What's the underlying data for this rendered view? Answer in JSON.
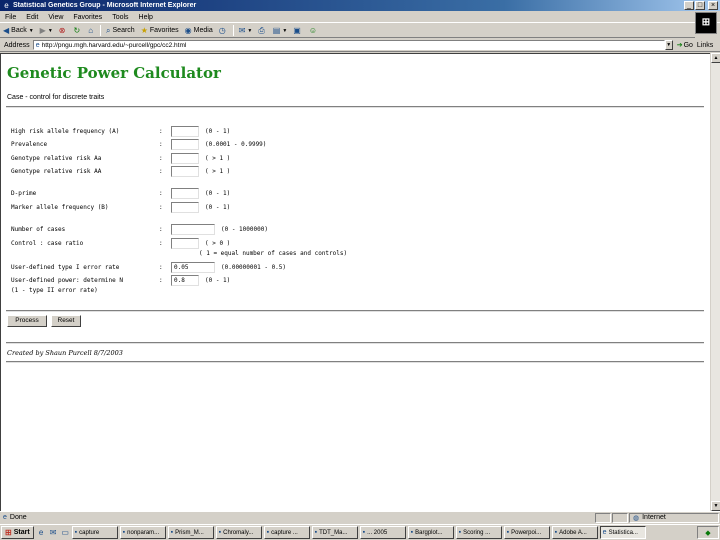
{
  "window": {
    "title": "Statistical Genetics Group - Microsoft Internet Explorer",
    "btn_min": "_",
    "btn_max": "□",
    "btn_close": "×"
  },
  "menu": {
    "items": [
      "File",
      "Edit",
      "View",
      "Favorites",
      "Tools",
      "Help"
    ]
  },
  "toolbar": {
    "back": "Back",
    "forward": "",
    "search": "Search",
    "favorites": "Favorites",
    "media": "Media"
  },
  "address": {
    "label": "Address",
    "url": "http://pngu.mgh.harvard.edu/~purcell/gpc/cc2.html",
    "go": "Go",
    "links": "Links"
  },
  "page": {
    "title": "Genetic Power Calculator",
    "subtitle": "Case - control for discrete traits",
    "fields": [
      {
        "label": "High risk allele frequency (A)",
        "colon": ":",
        "value": "",
        "range": "(0 - 1)"
      },
      {
        "label": "Prevalence",
        "colon": ":",
        "value": "",
        "range": "(0.0001 - 0.9999)"
      },
      {
        "label": "Genotype relative risk Aa",
        "colon": ":",
        "value": "",
        "range": "( > 1 )"
      },
      {
        "label": "Genotype relative risk AA",
        "colon": ":",
        "value": "",
        "range": "( > 1 )"
      },
      {
        "label": "D-prime",
        "colon": ":",
        "value": "",
        "range": "(0 - 1)"
      },
      {
        "label": "Marker allele frequency (B)",
        "colon": ":",
        "value": "",
        "range": "(0 - 1)"
      },
      {
        "label": "Number of cases",
        "colon": ":",
        "value": "",
        "range": "(0 - 1000000)"
      },
      {
        "label": "Control : case ratio",
        "colon": ":",
        "value": "",
        "range": "( > 0 )"
      },
      {
        "label": "User-defined type I error rate",
        "colon": ":",
        "value": "0.05",
        "range": "(0.00000001 - 0.5)"
      },
      {
        "label": "User-defined power: determine N",
        "colon": ":",
        "value": "0.8",
        "range": "(0 - 1)"
      }
    ],
    "ratio_note": "( 1 = equal number of cases and controls)",
    "power_note": "(1 - type II error rate)",
    "process_button": "Process",
    "reset_button": "Reset",
    "credit": "Created by Shaun Purcell 8/7/2003"
  },
  "status": {
    "text": "Done",
    "zone": "Internet"
  },
  "taskbar": {
    "start": "Start",
    "tasks": [
      "capture",
      "nonparam...",
      "Prism_M...",
      "Chromaly...",
      "capture ...",
      "TDT_Ma...",
      "... 2005",
      "Bargplot...",
      "Scoring ...",
      "Powerpoi...",
      "Adobe A...",
      "Statistica..."
    ],
    "active_index": 11
  }
}
